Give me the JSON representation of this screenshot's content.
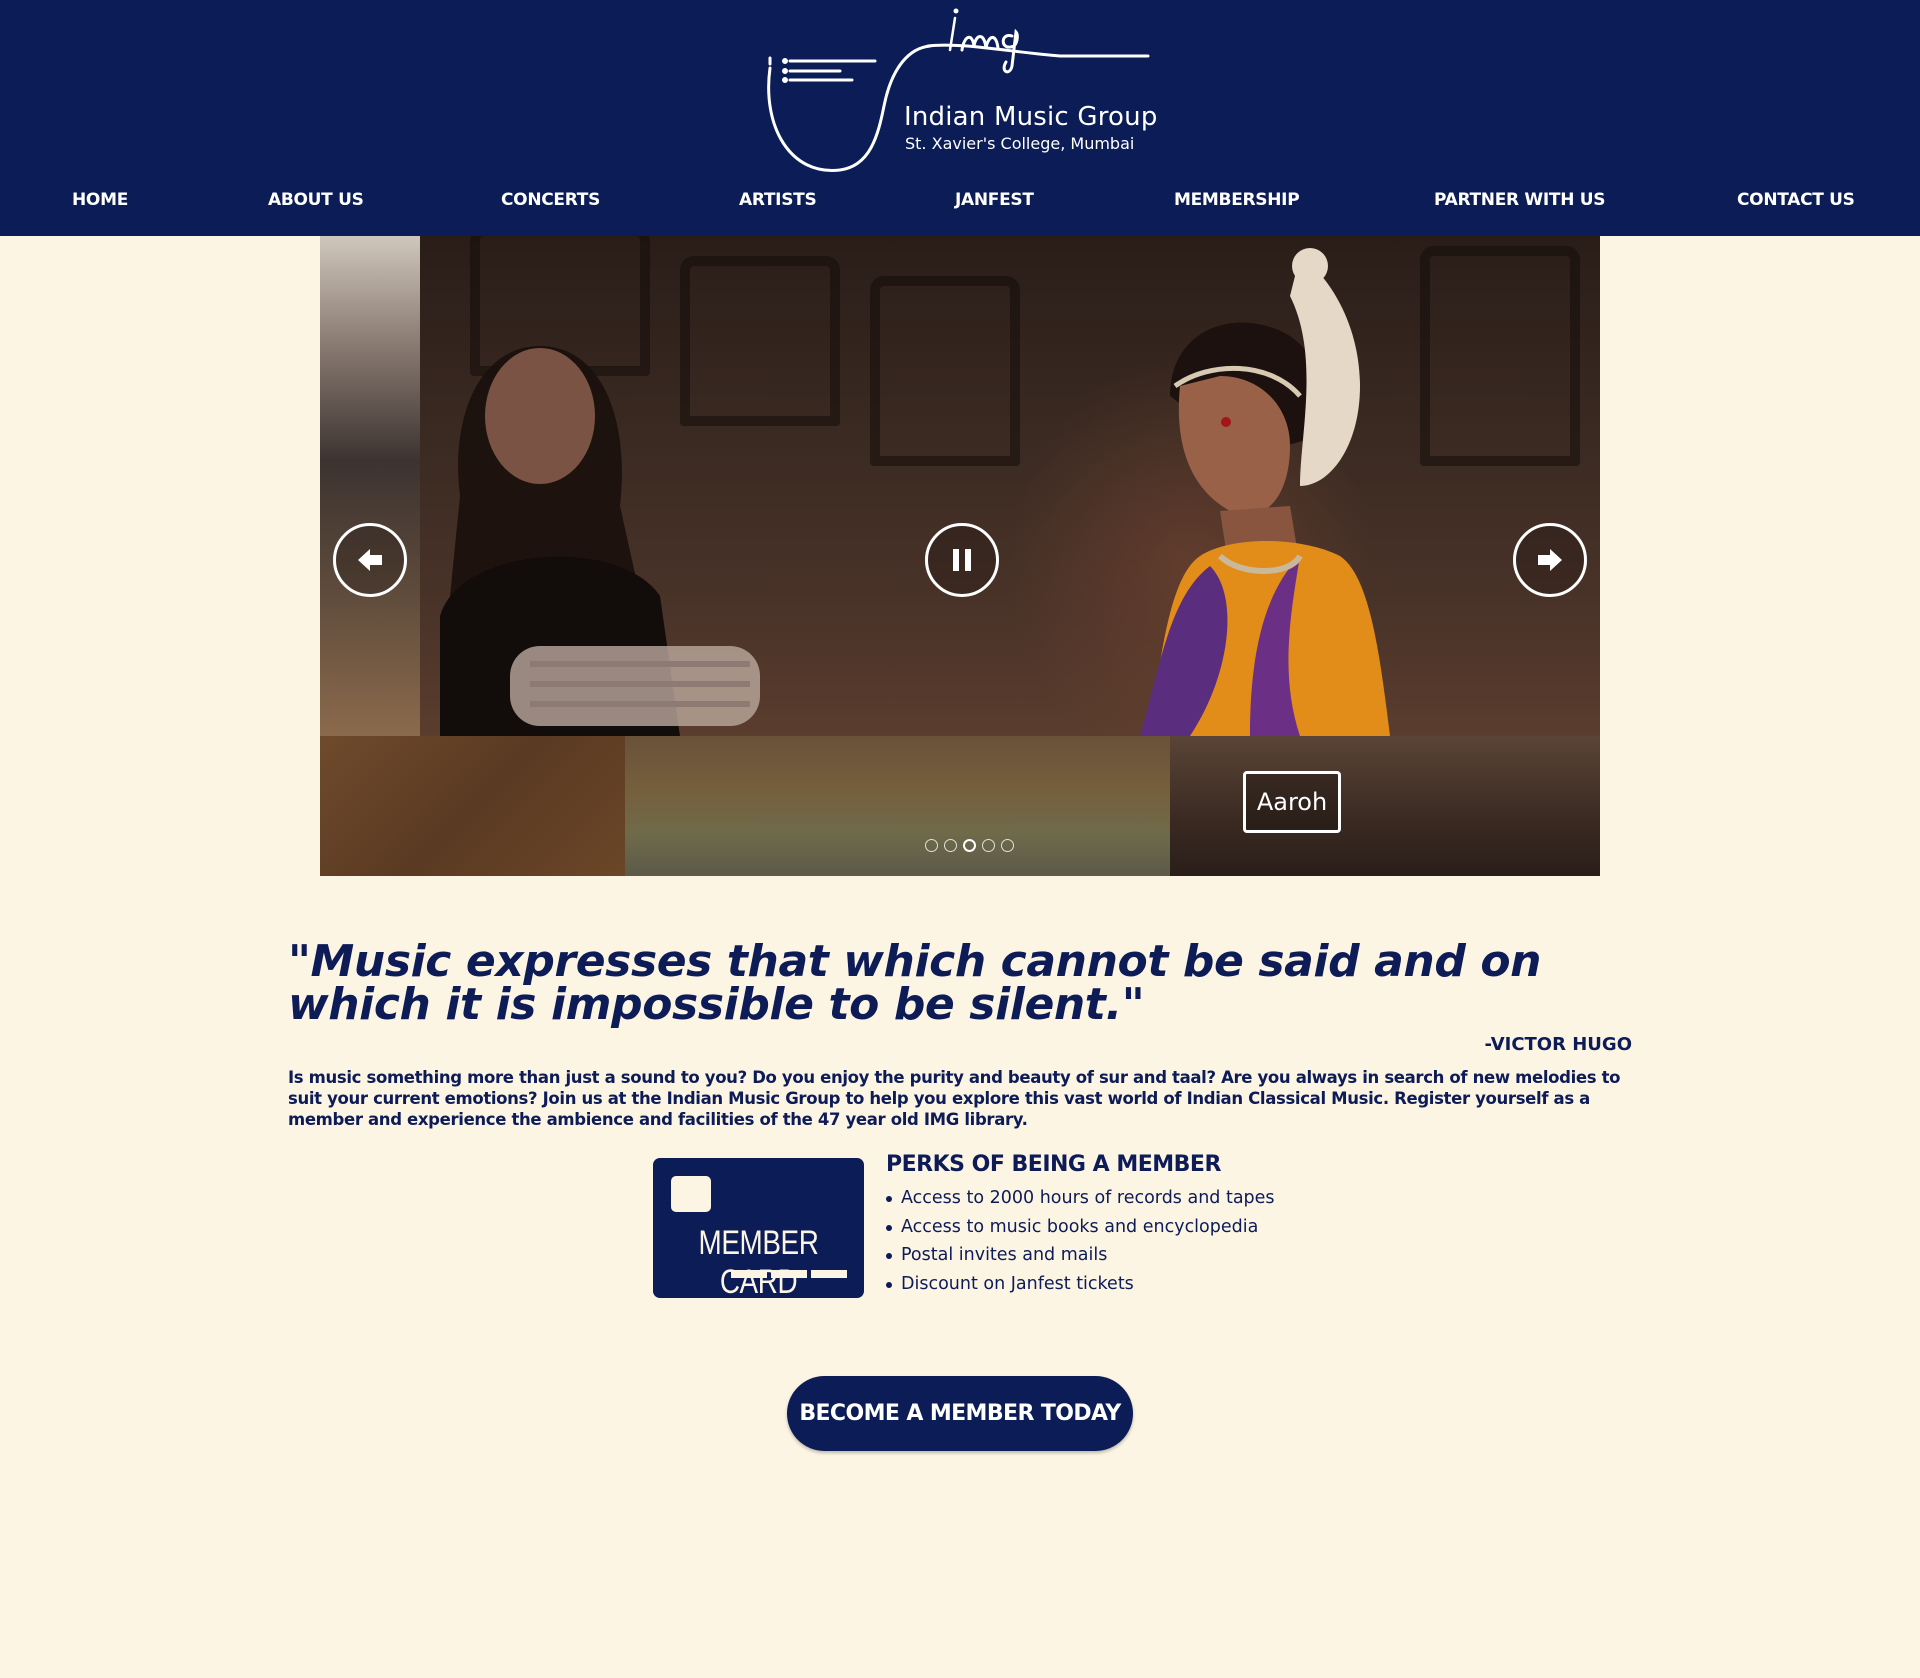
{
  "colors": {
    "navy": "#0b1c57",
    "cream": "#fcf5e4",
    "white": "#ffffff"
  },
  "header": {
    "logo_script": "img",
    "logo_title": "Indian Music Group",
    "logo_subtitle": "St. Xavier's College, Mumbai",
    "nav": [
      "HOME",
      "ABOUT US",
      "CONCERTS",
      "ARTISTS",
      "JANFEST",
      "MEMBERSHIP",
      "PARTNER WITH US",
      "CONTACT US"
    ]
  },
  "slider": {
    "caption": "Aaroh",
    "prev_icon": "arrow-left-icon",
    "pause_icon": "pause-icon",
    "next_icon": "arrow-right-icon",
    "dot_count": 5,
    "active_dot": 3
  },
  "quote": {
    "text": "\"Music expresses that which cannot be said and on which it is impossible to be silent.\"",
    "author": "-VICTOR HUGO"
  },
  "intro": "Is music something more than just a sound to you? Do you enjoy the purity and beauty of sur and taal? Are you always in search of new melodies to suit your current emotions? Join us at the Indian Music Group to help you explore this vast world of Indian Classical Music. Register yourself as a member and experience the ambience and facilities of the 47 year old IMG library.",
  "member_card": {
    "label": "MEMBER CARD",
    "icon": "member-card-icon"
  },
  "perks": {
    "title": "PERKS OF BEING A MEMBER",
    "items": [
      "Access to 2000 hours of records and tapes",
      "Access to music books and encyclopedia",
      "Postal invites and mails",
      "Discount on Janfest tickets"
    ]
  },
  "cta": {
    "label": "BECOME A MEMBER TODAY"
  }
}
